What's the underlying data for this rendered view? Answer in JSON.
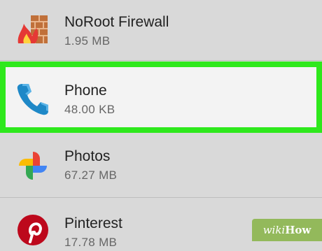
{
  "apps": [
    {
      "name": "NoRoot Firewall",
      "size": "1.95 MB",
      "icon": "firewall-icon"
    },
    {
      "name": "Phone",
      "size": "48.00 KB",
      "icon": "phone-icon",
      "highlighted": true
    },
    {
      "name": "Photos",
      "size": "67.27 MB",
      "icon": "photos-pinwheel-icon"
    },
    {
      "name": "Pinterest",
      "size": "17.78 MB",
      "icon": "pinterest-icon"
    }
  ],
  "watermark": {
    "prefix": "wiki",
    "suffix": "How"
  },
  "colors": {
    "background": "#d9d9d9",
    "highlight_border": "#2ee81c",
    "highlight_background": "#f3f3f3",
    "phone_blue": "#1e88c7",
    "pinterest_red": "#bd081c",
    "wikihow_green": "#93b95b"
  }
}
